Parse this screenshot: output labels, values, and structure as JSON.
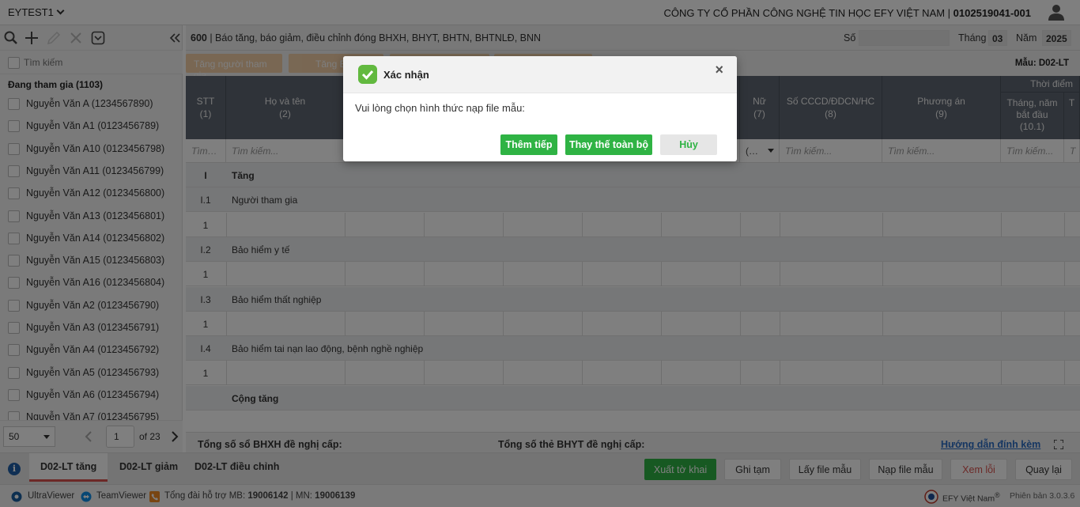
{
  "topbar": {
    "workspace": "EYTEST1",
    "company": "CÔNG TY CỔ PHẦN CÔNG NGHỆ TIN HỌC EFY VIỆT NAM | ",
    "tax_code": "0102519041-001"
  },
  "sidebar": {
    "search_placeholder": "Tìm kiếm",
    "group_label": "Đang tham gia (1103)",
    "employees": [
      "Nguyễn Văn A (1234567890)",
      "Nguyễn Văn A1 (0123456789)",
      "Nguyễn Văn A10 (0123456798)",
      "Nguyễn Văn A11 (0123456799)",
      "Nguyễn Văn A12 (0123456800)",
      "Nguyễn Văn A13 (0123456801)",
      "Nguyễn Văn A14 (0123456802)",
      "Nguyễn Văn A15 (0123456803)",
      "Nguyễn Văn A16 (0123456804)",
      "Nguyễn Văn A2 (0123456790)",
      "Nguyễn Văn A3 (0123456791)",
      "Nguyễn Văn A4 (0123456792)",
      "Nguyễn Văn A5 (0123456793)",
      "Nguyễn Văn A6 (0123456794)",
      "Nguyễn Văn A7 (0123456795)"
    ],
    "page_size": "50",
    "page": "1",
    "of_pages": "of 23"
  },
  "header": {
    "code": "600",
    "title": " | Báo tăng, báo giảm, điều chỉnh đóng BHXH, BHYT, BHTN, BHTNLĐ, BNN",
    "so_label": "Số",
    "so_value": "",
    "thang_label": "Tháng",
    "thang_value": "03",
    "nam_label": "Năm",
    "nam_value": "2025"
  },
  "subtabs": [
    "Tăng người tham gia",
    "Tăng B",
    "",
    ""
  ],
  "mau": "Mẫu: D02-LT",
  "columns": {
    "stt": "STT",
    "stt_n": "(1)",
    "name": "Họ và tên",
    "name_n": "(2)",
    "nu": "Nữ",
    "nu_n": "(7)",
    "cccd": "Số CCCD/ĐDCN/HC",
    "cccd_n": "(8)",
    "pa": "Phương án",
    "pa_n": "(9)",
    "tdiem": "Thời điểm",
    "start1": "Tháng, năm",
    "start2": "bắt đầu",
    "start_n": "(10.1)",
    "trunc": "T"
  },
  "filters": {
    "stt": "Tìm…",
    "name": "Tìm kiếm...",
    "nu": "(…",
    "cccd": "Tìm kiếm...",
    "pa": "Tìm kiếm...",
    "start": "Tìm kiếm...",
    "trunc": "T"
  },
  "rows": [
    {
      "type": "group",
      "n": "I",
      "d": "Tăng",
      "bold": true
    },
    {
      "type": "group",
      "n": "I.1",
      "d": "Người tham gia"
    },
    {
      "type": "data",
      "n": "1"
    },
    {
      "type": "group",
      "n": "I.2",
      "d": "Bảo hiểm y tế"
    },
    {
      "type": "data",
      "n": "1"
    },
    {
      "type": "group",
      "n": "I.3",
      "d": "Bảo hiểm thất nghiệp"
    },
    {
      "type": "data",
      "n": "1"
    },
    {
      "type": "group",
      "n": "I.4",
      "d": "Bảo hiểm tai nạn lao động, bệnh nghề nghiệp"
    },
    {
      "type": "data",
      "n": "1"
    },
    {
      "type": "group",
      "n": "",
      "d": "Cộng tăng",
      "bold": true
    }
  ],
  "footer": {
    "total_bhxh": "Tổng số sổ BHXH đề nghị cấp:",
    "total_bhyt": "Tổng số thẻ BHYT đề nghị cấp:",
    "guide": "Hướng dẫn đính kèm"
  },
  "bottom_tabs": [
    "D02-LT tăng",
    "D02-LT giảm",
    "D02-LT điều chỉnh"
  ],
  "actions": {
    "export": "Xuất tờ khai",
    "save": "Ghi tạm",
    "get_template": "Lấy file mẫu",
    "load_template": "Nạp file mẫu",
    "errors": "Xem lỗi",
    "back": "Quay lại"
  },
  "status": {
    "ultraviewer": "UltraViewer",
    "teamviewer": "TeamViewer",
    "hotline_prefix": "Tổng đài hỗ trợ MB: ",
    "hotline_mb": "19006142",
    "hotline_sep": " | MN: ",
    "hotline_mn": "19006139",
    "brand": "EFY Việt Nam",
    "brand_mark": "®",
    "version": "Phiên bản 3.0.3.6"
  },
  "modal": {
    "title": "Xác nhận",
    "message": "Vui lòng chọn hình thức nạp file mẫu:",
    "btn_append": "Thêm tiếp",
    "btn_replace": "Thay thế toàn bộ",
    "btn_cancel": "Hủy",
    "close": "×"
  },
  "colors": {
    "header_bg": "#5f6773",
    "green": "#2fb344",
    "orange": "#f4c896",
    "link": "#2b6cc4",
    "error": "#d9534f"
  }
}
